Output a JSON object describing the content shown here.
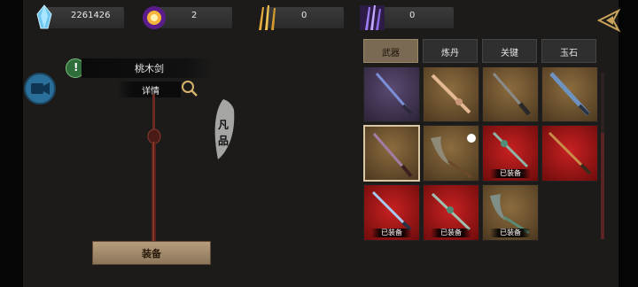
{
  "resources": [
    {
      "name": "crystal",
      "icon": "blue-crystal-icon",
      "value": "2261426"
    },
    {
      "name": "orb",
      "icon": "golden-orb-icon",
      "value": "2"
    },
    {
      "name": "gold-swords",
      "icon": "gold-swords-icon",
      "value": "0"
    },
    {
      "name": "purple-swords",
      "icon": "purple-swords-icon",
      "value": "0"
    }
  ],
  "weapon": {
    "name": "桃木剑",
    "detail_label": "详情",
    "rarity_1": "凡",
    "rarity_2": "品",
    "equip_label": "装备"
  },
  "tabs": [
    {
      "label": "武器",
      "active": true
    },
    {
      "label": "炼丹",
      "active": false
    },
    {
      "label": "关键",
      "active": false
    },
    {
      "label": "玉石",
      "active": false
    }
  ],
  "items": [
    {
      "quality": "purple",
      "weapon": "blue-sword-icon",
      "equipped_label": ""
    },
    {
      "quality": "gold",
      "weapon": "peach-wood-sword-icon",
      "equipped_label": ""
    },
    {
      "quality": "gold",
      "weapon": "dark-sword-icon",
      "equipped_label": ""
    },
    {
      "quality": "gold",
      "weapon": "blue-blade-icon",
      "equipped_label": ""
    },
    {
      "quality": "gold",
      "weapon": "red-wood-sword-icon",
      "equipped_label": "",
      "selected": true
    },
    {
      "quality": "gold",
      "weapon": "whisk-icon",
      "equipped_label": ""
    },
    {
      "quality": "red",
      "weapon": "jade-sword-icon",
      "equipped_label": "已装备"
    },
    {
      "quality": "red",
      "weapon": "bronze-sword-icon",
      "equipped_label": ""
    },
    {
      "quality": "red",
      "weapon": "ice-sword-icon",
      "equipped_label": "已装备"
    },
    {
      "quality": "red",
      "weapon": "jade-rod-icon",
      "equipped_label": "已装备"
    },
    {
      "quality": "red",
      "weapon": "jade-whisk-icon",
      "equipped_label": "已装备"
    }
  ],
  "colors": {
    "purple": "#3d2f4e",
    "gold": "#6b5230",
    "red": "#a81818",
    "equip_button": "#a58c6c"
  }
}
